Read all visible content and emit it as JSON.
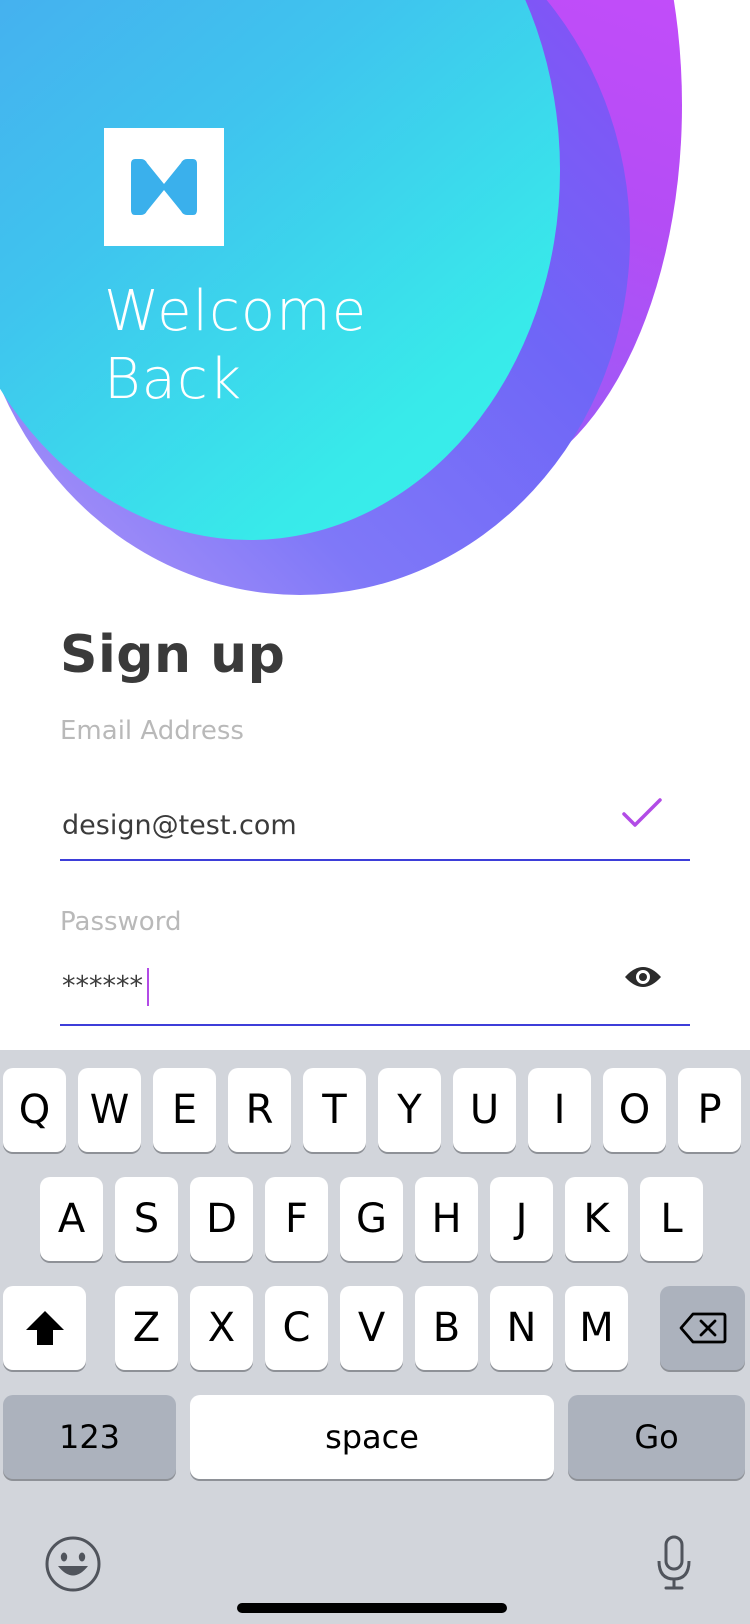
{
  "hero": {
    "welcome_line1": "Welcome",
    "welcome_line2": "Back",
    "logo_icon": "bowtie-m-logo-icon",
    "colors": {
      "teal": "#3af3e8",
      "blue": "#4aa2f0",
      "purple": "#6f66f7",
      "magenta": "#d24dff"
    }
  },
  "form": {
    "title": "Sign up",
    "email": {
      "label": "Email Address",
      "value": "design@test.com",
      "status_icon": "check-icon"
    },
    "password": {
      "label": "Password",
      "value": "******",
      "toggle_icon": "eye-icon"
    },
    "underline_color": "#3d3ed9",
    "accent_color": "#b24be6"
  },
  "keyboard": {
    "row1": [
      "Q",
      "W",
      "E",
      "R",
      "T",
      "Y",
      "U",
      "I",
      "O",
      "P"
    ],
    "row2": [
      "A",
      "S",
      "D",
      "F",
      "G",
      "H",
      "J",
      "K",
      "L"
    ],
    "row3": [
      "Z",
      "X",
      "C",
      "V",
      "B",
      "N",
      "M"
    ],
    "shift_icon": "shift-icon",
    "backspace_icon": "backspace-icon",
    "numbers_label": "123",
    "space_label": "space",
    "go_label": "Go",
    "emoji_icon": "emoji-icon",
    "mic_icon": "microphone-icon"
  }
}
